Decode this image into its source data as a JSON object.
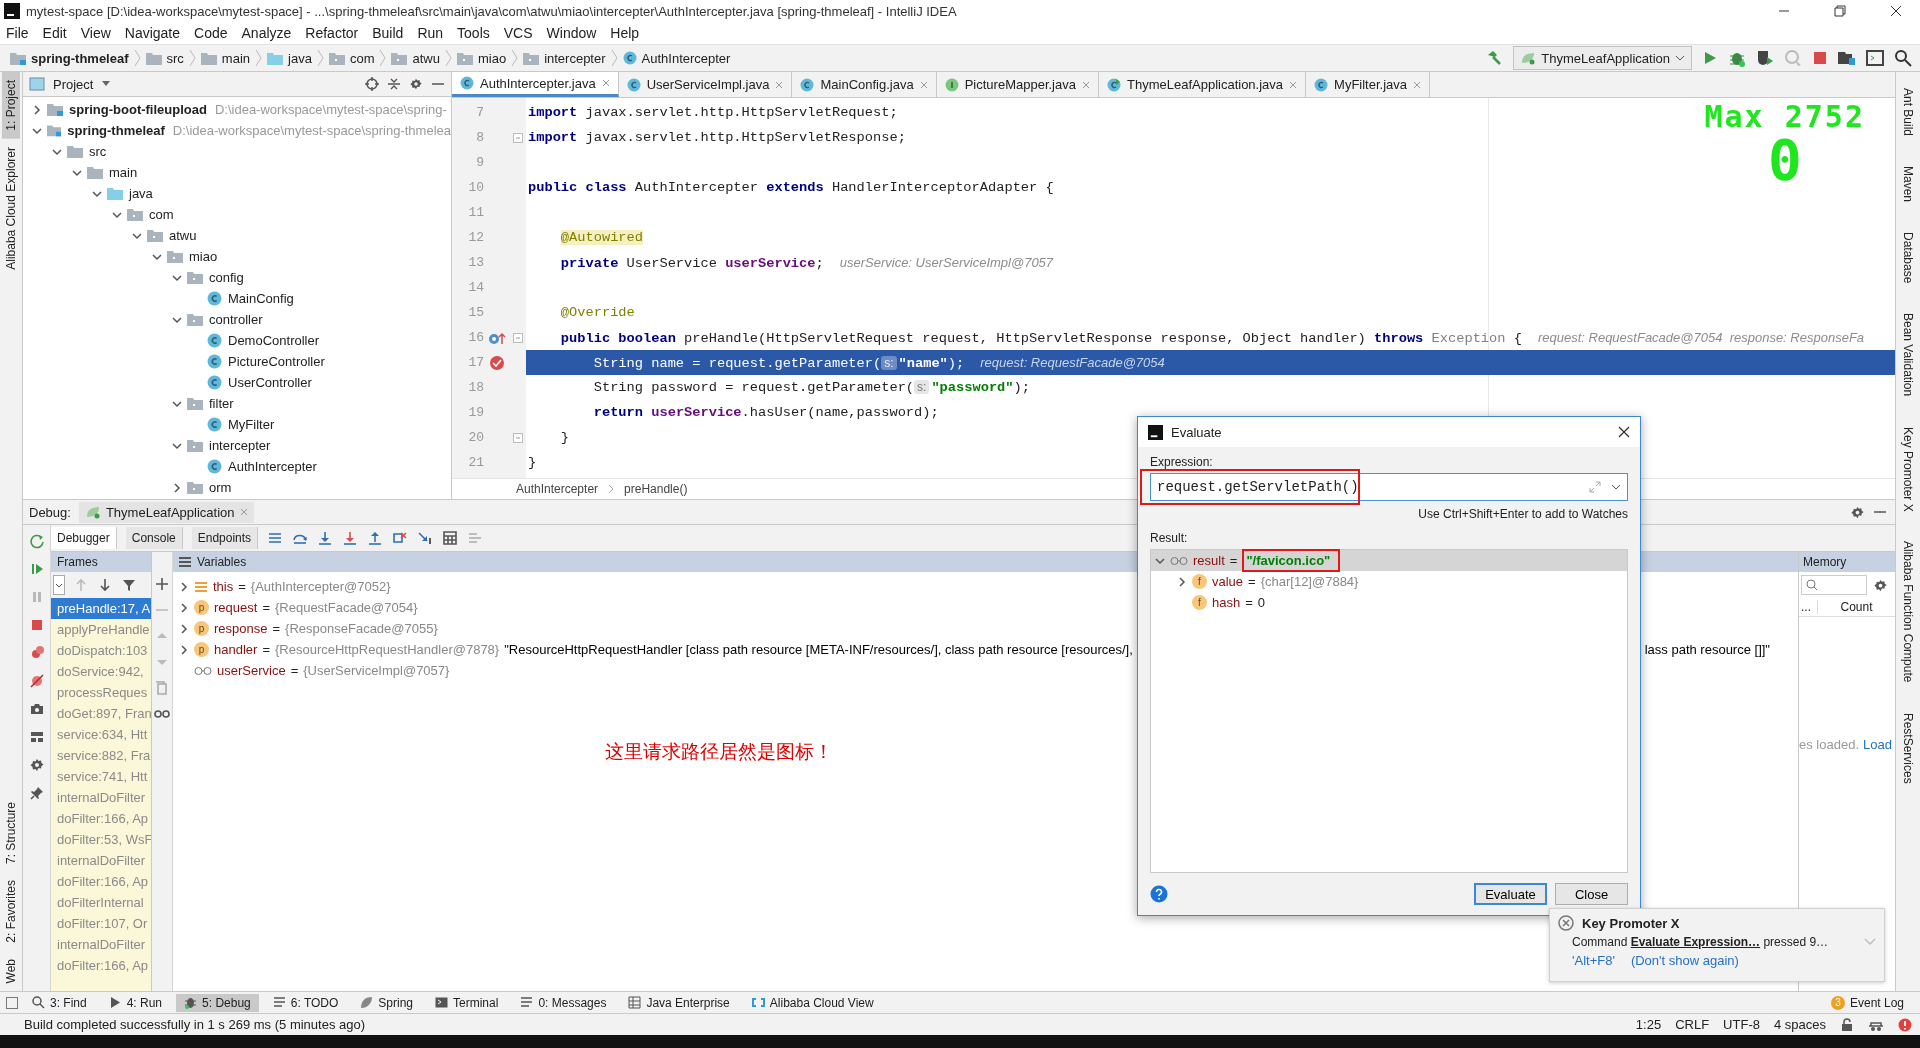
{
  "window": {
    "title": "mytest-space [D:\\idea-workspace\\mytest-space] - ...\\spring-thmeleaf\\src\\main\\java\\com\\atwu\\miao\\intercepter\\AuthIntercepter.java [spring-thmeleaf] - IntelliJ IDEA"
  },
  "menu": [
    "File",
    "Edit",
    "View",
    "Navigate",
    "Code",
    "Analyze",
    "Refactor",
    "Build",
    "Run",
    "Tools",
    "VCS",
    "Window",
    "Help"
  ],
  "breadcrumb": [
    {
      "label": "spring-thmeleaf",
      "kind": "module"
    },
    {
      "label": "src",
      "kind": "folder"
    },
    {
      "label": "main",
      "kind": "folder"
    },
    {
      "label": "java",
      "kind": "source"
    },
    {
      "label": "com",
      "kind": "package"
    },
    {
      "label": "atwu",
      "kind": "package"
    },
    {
      "label": "miao",
      "kind": "package"
    },
    {
      "label": "intercepter",
      "kind": "package"
    },
    {
      "label": "AuthIntercepter",
      "kind": "class"
    }
  ],
  "run_config": "ThymeLeafApplication",
  "left_tools_top": [
    {
      "label": "1: Project",
      "selected": true
    },
    {
      "label": "Alibaba Cloud Explorer",
      "selected": false
    }
  ],
  "left_tools_bottom": [
    {
      "label": "7: Structure",
      "selected": false
    },
    {
      "label": "2: Favorites",
      "selected": false
    },
    {
      "label": "Web",
      "selected": false
    }
  ],
  "right_tools": [
    "Ant Build",
    "Maven",
    "Database",
    "Bean Validation",
    "Key Promoter X",
    "Alibaba Function Compute",
    "RestServices"
  ],
  "project": {
    "title": "Project",
    "tree": [
      {
        "label": "spring-boot-fileupload",
        "kind": "module",
        "path": "D:\\idea-workspace\\mytest-space\\spring-",
        "expanded": false
      },
      {
        "label": "spring-thmeleaf",
        "kind": "module",
        "path": "D:\\idea-workspace\\mytest-space\\spring-thmelea",
        "expanded": true,
        "children": [
          {
            "label": "src",
            "kind": "folder",
            "expanded": true,
            "children": [
              {
                "label": "main",
                "kind": "folder",
                "expanded": true,
                "children": [
                  {
                    "label": "java",
                    "kind": "source",
                    "expanded": true,
                    "children": [
                      {
                        "label": "com",
                        "kind": "package",
                        "expanded": true,
                        "children": [
                          {
                            "label": "atwu",
                            "kind": "package",
                            "expanded": true,
                            "children": [
                              {
                                "label": "miao",
                                "kind": "package",
                                "expanded": true,
                                "children": [
                                  {
                                    "label": "config",
                                    "kind": "package",
                                    "expanded": true,
                                    "children": [
                                      {
                                        "label": "MainConfig",
                                        "kind": "class"
                                      }
                                    ]
                                  },
                                  {
                                    "label": "controller",
                                    "kind": "package",
                                    "expanded": true,
                                    "children": [
                                      {
                                        "label": "DemoController",
                                        "kind": "class"
                                      },
                                      {
                                        "label": "PictureController",
                                        "kind": "class"
                                      },
                                      {
                                        "label": "UserController",
                                        "kind": "class"
                                      }
                                    ]
                                  },
                                  {
                                    "label": "filter",
                                    "kind": "package",
                                    "expanded": true,
                                    "children": [
                                      {
                                        "label": "MyFilter",
                                        "kind": "class"
                                      }
                                    ]
                                  },
                                  {
                                    "label": "intercepter",
                                    "kind": "package",
                                    "expanded": true,
                                    "children": [
                                      {
                                        "label": "AuthIntercepter",
                                        "kind": "class"
                                      }
                                    ]
                                  },
                                  {
                                    "label": "orm",
                                    "kind": "package",
                                    "expanded": false
                                  }
                                ]
                              }
                            ]
                          }
                        ]
                      }
                    ]
                  }
                ]
              }
            ]
          }
        ]
      }
    ]
  },
  "editor_tabs": [
    {
      "label": "AuthIntercepter.java",
      "kind": "class",
      "selected": true
    },
    {
      "label": "UserServiceImpl.java",
      "kind": "class",
      "selected": false
    },
    {
      "label": "MainConfig.java",
      "kind": "class",
      "selected": false
    },
    {
      "label": "PictureMapper.java",
      "kind": "interface",
      "selected": false
    },
    {
      "label": "ThymeLeafApplication.java",
      "kind": "app",
      "selected": false
    },
    {
      "label": "MyFilter.java",
      "kind": "class",
      "selected": false
    }
  ],
  "code": [
    {
      "n": "7",
      "tokens": [
        {
          "kind": "kw",
          "t": "import"
        },
        {
          "kind": "plain",
          "t": " javax.servlet.http.HttpServletRequest;"
        }
      ]
    },
    {
      "n": "8",
      "fold": true,
      "tokens": [
        {
          "kind": "kw",
          "t": "import"
        },
        {
          "kind": "plain",
          "t": " javax.servlet.http.HttpServletResponse;"
        }
      ]
    },
    {
      "n": "9"
    },
    {
      "n": "10",
      "tokens": [
        {
          "kind": "kw",
          "t": "public class"
        },
        {
          "kind": "plain",
          "t": " AuthIntercepter "
        },
        {
          "kind": "kw",
          "t": "extends"
        },
        {
          "kind": "plain",
          "t": " HandlerInterceptorAdapter {"
        }
      ]
    },
    {
      "n": "11"
    },
    {
      "n": "12",
      "tokens": [
        {
          "kind": "ann",
          "t": "    @Autowired"
        }
      ]
    },
    {
      "n": "13",
      "tokens": [
        {
          "kind": "kw",
          "t": "    private"
        },
        {
          "kind": "plain",
          "t": " UserService "
        },
        {
          "kind": "field",
          "t": "userService"
        },
        {
          "kind": "plain",
          "t": ";"
        },
        {
          "kind": "hint",
          "t": "userService: UserServiceImpl@7057"
        }
      ]
    },
    {
      "n": "14"
    },
    {
      "n": "15",
      "tokens": [
        {
          "kind": "annotation",
          "t": "    @Override"
        }
      ]
    },
    {
      "n": "16",
      "kind": "method",
      "fold": true,
      "tokens": [
        {
          "kind": "kw",
          "t": "    public boolean"
        },
        {
          "kind": "plain",
          "t": " preHandle(HttpServletRequest request, HttpServletResponse response, Object handler) "
        },
        {
          "kind": "kw",
          "t": "throws"
        },
        {
          "kind": "ref",
          "t": " Exception"
        },
        {
          "kind": "plain",
          "t": " {"
        },
        {
          "kind": "hint",
          "t": "request: RequestFacade@7054  response: ResponseFa"
        }
      ]
    },
    {
      "n": "17",
      "kind": "breakpoint",
      "current": true,
      "tokens": [
        {
          "kind": "plain",
          "t": "        String name = request.getParameter("
        },
        {
          "kind": "param",
          "t": "s:"
        },
        {
          "kind": "str",
          "t": "\"name\""
        },
        {
          "kind": "plain",
          "t": ");"
        },
        {
          "kind": "hint",
          "t": "request: RequestFacade@7054"
        }
      ]
    },
    {
      "n": "18",
      "tokens": [
        {
          "kind": "plain",
          "t": "        String password = request.getParameter("
        },
        {
          "kind": "param",
          "t": "s:"
        },
        {
          "kind": "str",
          "t": "\"password\""
        },
        {
          "kind": "plain",
          "t": ");"
        }
      ]
    },
    {
      "n": "19",
      "tokens": [
        {
          "kind": "kw",
          "t": "        return"
        },
        {
          "kind": "field",
          "t": " userService"
        },
        {
          "kind": "plain",
          "t": ".hasUser(name,password);"
        }
      ]
    },
    {
      "n": "20",
      "fold": true,
      "tokens": [
        {
          "kind": "plain",
          "t": "    }"
        }
      ]
    },
    {
      "n": "21",
      "tokens": [
        {
          "kind": "plain",
          "t": "}"
        }
      ]
    }
  ],
  "power_mode": {
    "max": "Max 2752",
    "combo": "0"
  },
  "editor_breadcrumb": [
    "AuthIntercepter",
    "preHandle()"
  ],
  "debug": {
    "label": "Debug:",
    "session": "ThymeLeafApplication",
    "tabs": [
      {
        "label": "Debugger",
        "selected": true
      },
      {
        "label": "Console",
        "selected": false
      },
      {
        "label": "Endpoints",
        "selected": false
      }
    ],
    "frames_title": "Frames",
    "frames": [
      {
        "label": "preHandle:17, A",
        "selected": true
      },
      {
        "label": "applyPreHandle",
        "selected": false
      },
      {
        "label": "doDispatch:103",
        "selected": false
      },
      {
        "label": "doService:942,",
        "selected": false
      },
      {
        "label": "processReques",
        "selected": false
      },
      {
        "label": "doGet:897, Fran",
        "selected": false
      },
      {
        "label": "service:634, Htt",
        "selected": false
      },
      {
        "label": "service:882, Fra",
        "selected": false
      },
      {
        "label": "service:741, Htt",
        "selected": false
      },
      {
        "label": "internalDoFilter",
        "selected": false
      },
      {
        "label": "doFilter:166, Ap",
        "selected": false
      },
      {
        "label": "doFilter:53, WsF",
        "selected": false
      },
      {
        "label": "internalDoFilter",
        "selected": false
      },
      {
        "label": "doFilter:166, Ap",
        "selected": false
      },
      {
        "label": "doFilterInternal",
        "selected": false
      },
      {
        "label": "doFilter:107, Or",
        "selected": false
      },
      {
        "label": "internalDoFilter",
        "selected": false
      },
      {
        "label": "doFilter:166, Ap",
        "selected": false
      }
    ],
    "variables_title": "Variables",
    "variables": [
      {
        "kind": "this",
        "name": "this",
        "eq": "=",
        "value": "{AuthIntercepter@7052}"
      },
      {
        "kind": "param",
        "badge": "p",
        "name": "request",
        "eq": "=",
        "value": "{RequestFacade@7054}"
      },
      {
        "kind": "param",
        "badge": "p",
        "name": "response",
        "eq": "=",
        "value": "{ResponseFacade@7055}"
      },
      {
        "kind": "param",
        "badge": "p",
        "name": "handler",
        "eq": "=",
        "value": "{ResourceHttpRequestHandler@7878}",
        "text": "\"ResourceHttpRequestHandler [class path resource [META-INF/resources/], class path resource [resources/],",
        "tail": "lass path resource []]\""
      },
      {
        "kind": "watch",
        "name": "userService",
        "eq": "=",
        "value": "{UserServiceImpl@7057}"
      }
    ],
    "note": "这里请求路径居然是图标！",
    "memory": {
      "title": "Memory",
      "columns": [
        "...",
        "Count"
      ],
      "status": "es loaded.",
      "link": "Load"
    }
  },
  "evaluate": {
    "title": "Evaluate",
    "expression_label": "Expression:",
    "expression": "request.getServletPath()",
    "hint": "Use Ctrl+Shift+Enter to add to Watches",
    "result_label": "Result:",
    "result": [
      {
        "kind": "watch",
        "name": "result",
        "eq": "=",
        "value": "\"/favicon.ico\"",
        "expanded": true,
        "selected": true,
        "children": [
          {
            "kind": "field",
            "badge": "f",
            "name": "value",
            "eq": "=",
            "value": "{char[12]@7884}",
            "expanded": false
          },
          {
            "kind": "field",
            "badge": "f",
            "name": "hash",
            "eq": "=",
            "value": "0"
          }
        ]
      }
    ],
    "buttons": [
      {
        "label": "Evaluate",
        "default": true
      },
      {
        "label": "Close",
        "default": false
      }
    ]
  },
  "key_promoter": {
    "title": "Key Promoter X",
    "message": "Command **Evaluate Expression…** pressed 9…",
    "shortcut": "'Alt+F8'",
    "dismiss": "(Don't show again)"
  },
  "tool_tabs": [
    {
      "label": "3: Find",
      "kind": "search",
      "selected": false
    },
    {
      "label": "4: Run",
      "kind": "run",
      "selected": false
    },
    {
      "label": "5: Debug",
      "kind": "bug",
      "selected": true
    },
    {
      "label": "6: TODO",
      "kind": "list",
      "selected": false
    },
    {
      "label": "Spring",
      "kind": "leaf",
      "selected": false
    },
    {
      "label": "Terminal",
      "kind": "terminal",
      "selected": false
    },
    {
      "label": "0: Messages",
      "kind": "list",
      "selected": false
    },
    {
      "label": "Java Enterprise",
      "kind": "grid",
      "selected": false
    },
    {
      "label": "Alibaba Cloud View",
      "kind": "cloud",
      "selected": false
    }
  ],
  "event_log": {
    "label": "Event Log",
    "count": "3"
  },
  "status": {
    "message": "Build completed successfully in 1 s 269 ms (5 minutes ago)",
    "items": [
      "1:25",
      "CRLF",
      "UTF-8",
      "4 spaces"
    ]
  }
}
